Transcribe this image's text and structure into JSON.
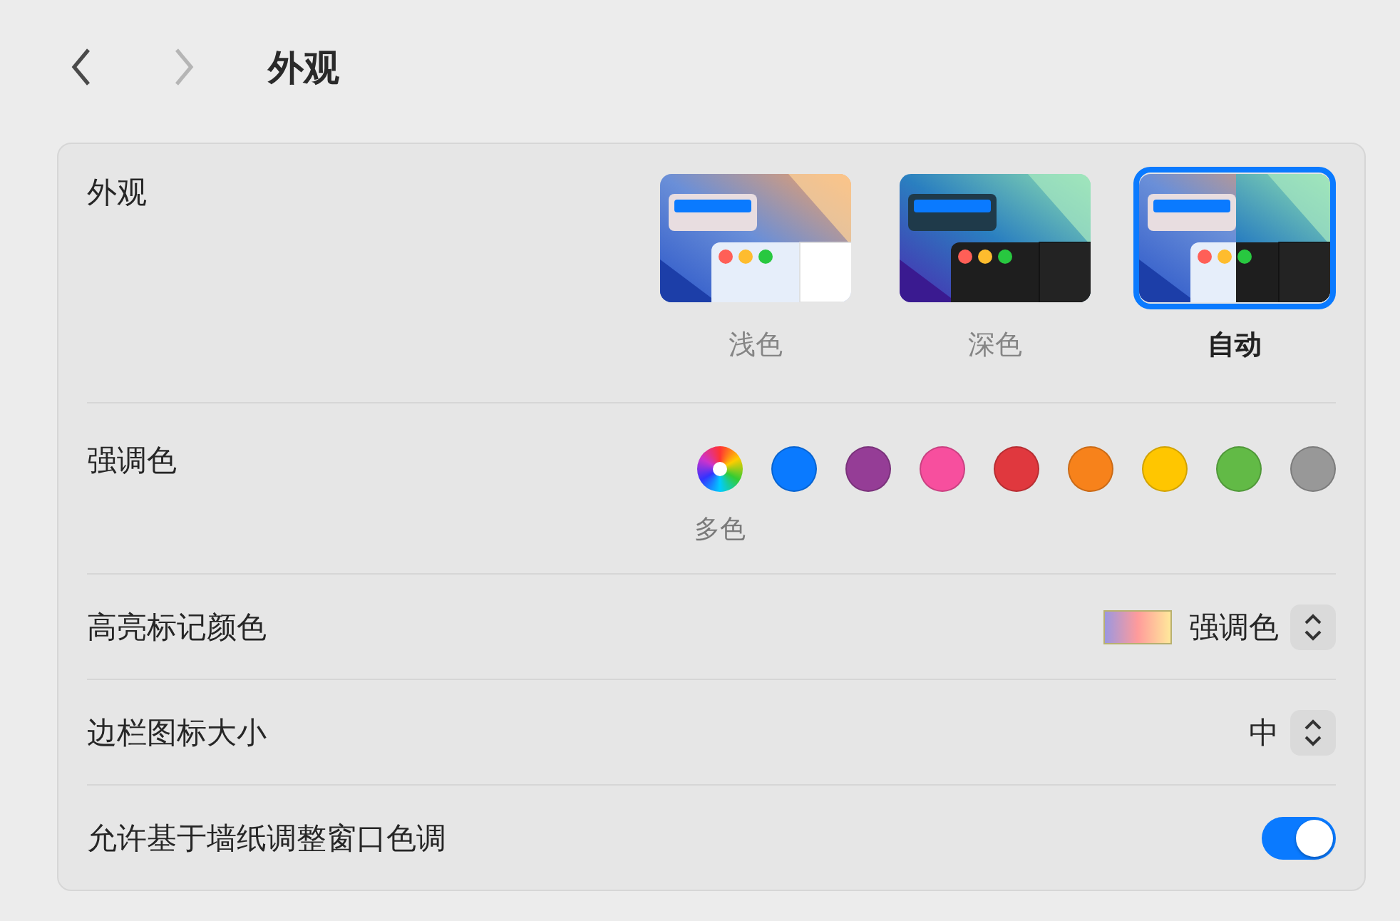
{
  "nav": {
    "forward_disabled": true,
    "title": "外观"
  },
  "appearance": {
    "label": "外观",
    "options": [
      {
        "kind": "light",
        "label": "浅色",
        "selected": false
      },
      {
        "kind": "dark",
        "label": "深色",
        "selected": false
      },
      {
        "kind": "auto",
        "label": "自动",
        "selected": true
      }
    ]
  },
  "accent": {
    "label": "强调色",
    "swatches": [
      {
        "kind": "multi",
        "label": "多色"
      },
      {
        "kind": "solid",
        "color": "#0a7aff"
      },
      {
        "kind": "solid",
        "color": "#953d96"
      },
      {
        "kind": "solid",
        "color": "#f74f9e"
      },
      {
        "kind": "solid",
        "color": "#e0383e"
      },
      {
        "kind": "solid",
        "color": "#f7821b"
      },
      {
        "kind": "solid",
        "color": "#ffc600"
      },
      {
        "kind": "solid",
        "color": "#62ba46"
      },
      {
        "kind": "solid",
        "color": "#989898"
      }
    ]
  },
  "highlight": {
    "label": "高亮标记颜色",
    "value": "强调色"
  },
  "sidebar_icon_size": {
    "label": "边栏图标大小",
    "value": "中"
  },
  "wallpaper_tinting": {
    "label": "允许基于墙纸调整窗口色调",
    "on": true
  }
}
